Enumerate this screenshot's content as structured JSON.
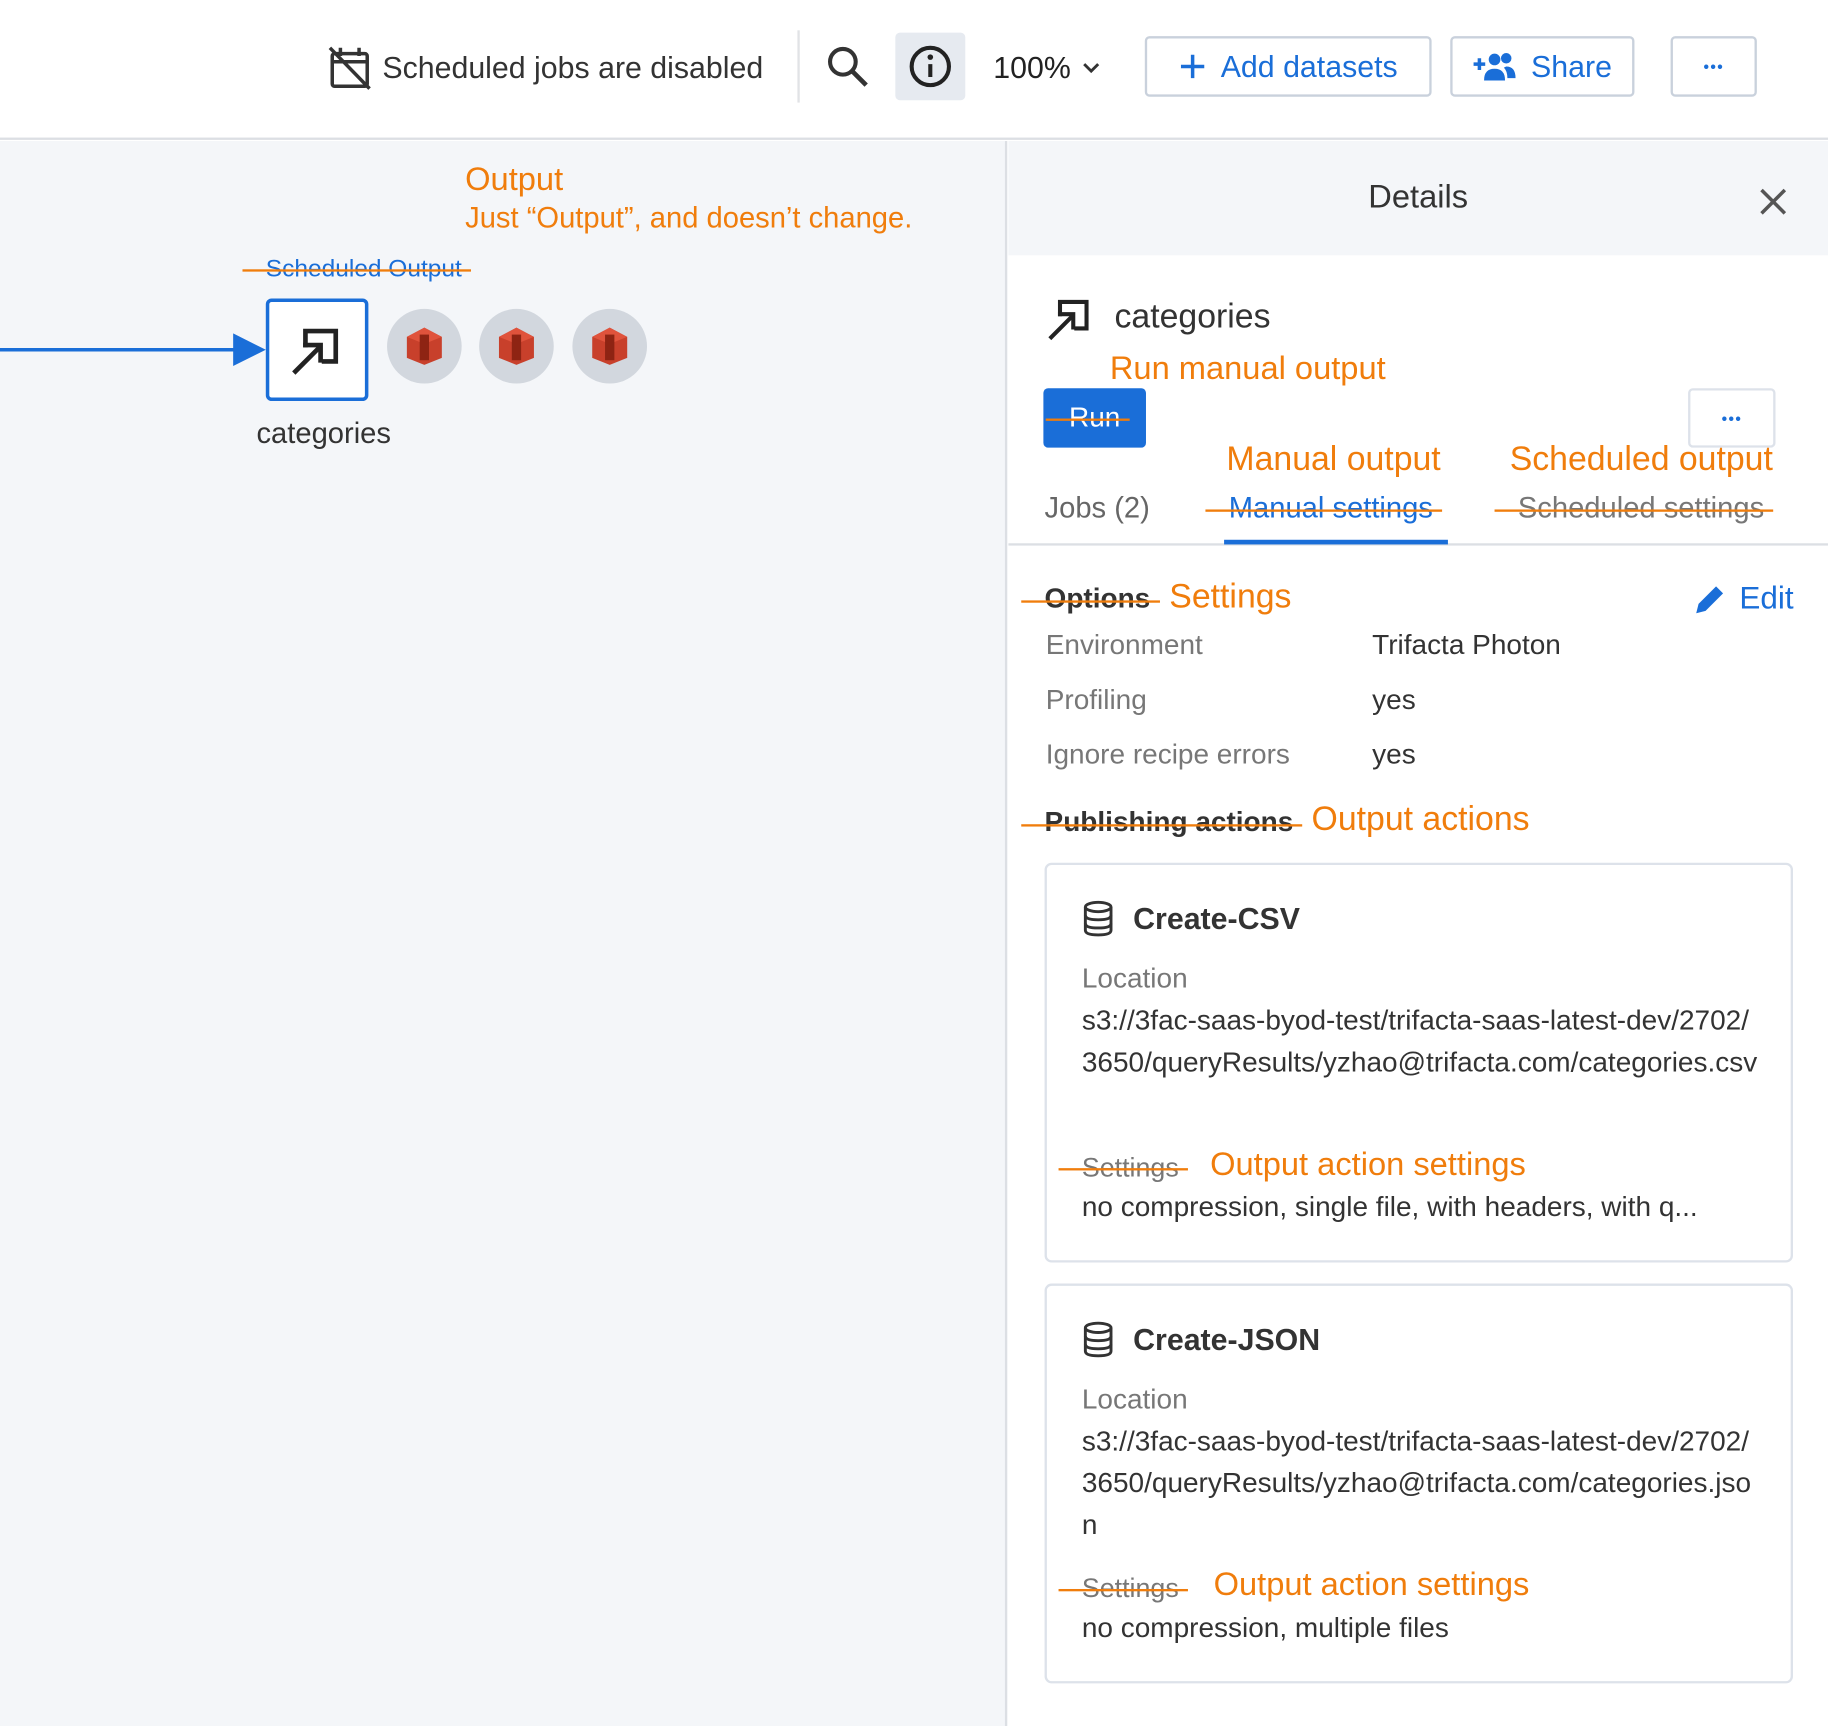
{
  "toolbar": {
    "scheduled_status": "Scheduled jobs are disabled",
    "zoom": "100%",
    "add_datasets": "Add datasets",
    "share": "Share",
    "more": "•••"
  },
  "canvas": {
    "annotation_title": "Output",
    "annotation_note": "Just “Output”, and doesn’t change.",
    "struck_label": "Scheduled Output",
    "node_name": "categories"
  },
  "details": {
    "title": "Details",
    "object_name": "categories",
    "run_annotation": "Run manual output",
    "run_button": "Run",
    "more": "•••",
    "tabs": {
      "jobs": "Jobs (2)",
      "manual_original": "Manual settings",
      "manual_new": "Manual output",
      "scheduled_original": "Scheduled settings",
      "scheduled_new": "Scheduled output"
    },
    "options_original": "Options",
    "options_new": "Settings",
    "edit": "Edit",
    "settings": [
      {
        "label": "Environment",
        "value": "Trifacta Photon"
      },
      {
        "label": "Profiling",
        "value": "yes"
      },
      {
        "label": "Ignore recipe errors",
        "value": "yes"
      }
    ],
    "publishing_original": "Publishing actions",
    "publishing_new": "Output actions",
    "actions": [
      {
        "name": "Create-CSV",
        "location_label": "Location",
        "location": "s3://3fac-saas-byod-test/trifacta-saas-latest-dev/2702/3650/queryResults/yzhao@trifacta.com/categories.csv",
        "settings_original": "Settings",
        "settings_new": "Output action settings",
        "settings_value": "no compression, single file, with headers, with q..."
      },
      {
        "name": "Create-JSON",
        "location_label": "Location",
        "location": "s3://3fac-saas-byod-test/trifacta-saas-latest-dev/2702/3650/queryResults/yzhao@trifacta.com/categories.json",
        "settings_original": "Settings",
        "settings_new": "Output action settings",
        "settings_value": "no compression, multiple files"
      }
    ]
  },
  "colors": {
    "accent": "#1a6ed8",
    "annotation": "#f07d0c",
    "canvas_bg": "#f4f6f9"
  }
}
